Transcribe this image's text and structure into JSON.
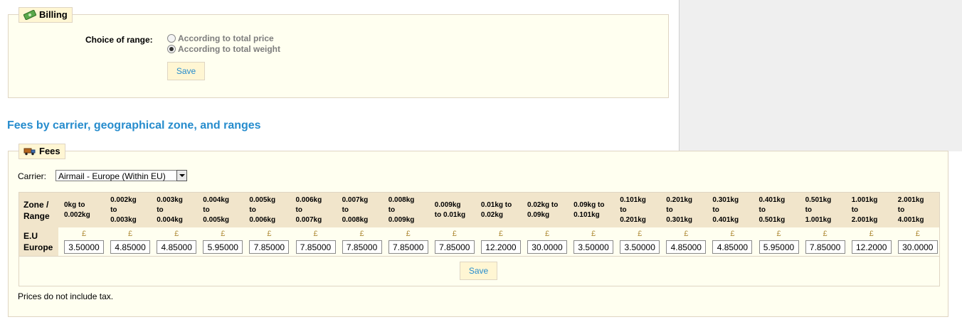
{
  "billing": {
    "legend": "Billing",
    "choice_label": "Choice of range:",
    "options": [
      {
        "label": "According to total price",
        "checked": false
      },
      {
        "label": "According to total weight",
        "checked": true
      }
    ],
    "save_label": "Save"
  },
  "section_title": "Fees by carrier, geographical zone, and ranges",
  "fees": {
    "legend": "Fees",
    "carrier_label": "Carrier:",
    "carrier_value": "Airmail - Europe (Within EU)",
    "zone_header": [
      "Zone /",
      "Range"
    ],
    "zone_name": [
      "E.U",
      "Europe"
    ],
    "currency_symbol": "£",
    "ranges": [
      [
        "0kg to",
        "0.002kg"
      ],
      [
        "0.002kg",
        "to",
        "0.003kg"
      ],
      [
        "0.003kg",
        "to",
        "0.004kg"
      ],
      [
        "0.004kg",
        "to",
        "0.005kg"
      ],
      [
        "0.005kg",
        "to",
        "0.006kg"
      ],
      [
        "0.006kg",
        "to",
        "0.007kg"
      ],
      [
        "0.007kg",
        "to",
        "0.008kg"
      ],
      [
        "0.008kg",
        "to",
        "0.009kg"
      ],
      [
        "0.009kg",
        "to 0.01kg"
      ],
      [
        "0.01kg to",
        "0.02kg"
      ],
      [
        "0.02kg to",
        "0.09kg"
      ],
      [
        "0.09kg to",
        "0.101kg"
      ],
      [
        "0.101kg",
        "to",
        "0.201kg"
      ],
      [
        "0.201kg",
        "to",
        "0.301kg"
      ],
      [
        "0.301kg",
        "to",
        "0.401kg"
      ],
      [
        "0.401kg",
        "to",
        "0.501kg"
      ],
      [
        "0.501kg",
        "to",
        "1.001kg"
      ],
      [
        "1.001kg",
        "to",
        "2.001kg"
      ],
      [
        "2.001kg",
        "to",
        "4.001kg"
      ]
    ],
    "values": [
      "3.50000",
      "4.85000",
      "4.85000",
      "5.95000",
      "7.85000",
      "7.85000",
      "7.85000",
      "7.85000",
      "7.85000",
      "12.2000",
      "30.0000",
      "3.50000",
      "3.50000",
      "4.85000",
      "4.85000",
      "5.95000",
      "7.85000",
      "12.2000",
      "30.0000"
    ],
    "save_label": "Save",
    "tax_note": "Prices do not include tax."
  }
}
